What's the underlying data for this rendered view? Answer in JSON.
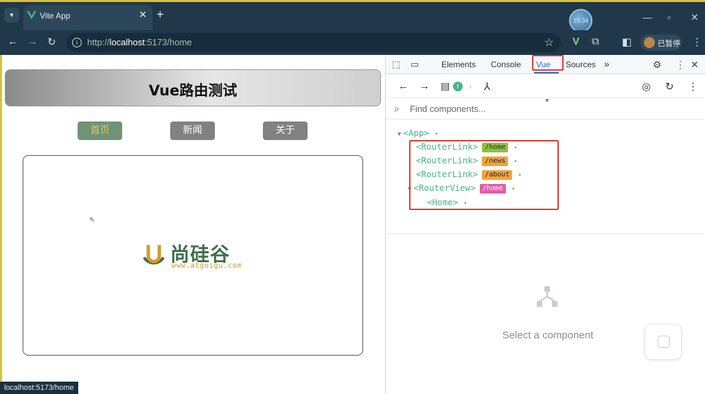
{
  "browser": {
    "tab_title": "Vite App",
    "close": "✕",
    "new_tab": "+",
    "url_prefix": "http://",
    "url_host": "localhost",
    "url_rest": ":5173/home",
    "profile_bubble": "15:34",
    "paused_label": "已暂停",
    "status_url": "localhost:5173/home"
  },
  "page": {
    "heading": "Vue路由测试",
    "nav": [
      {
        "label": "首页",
        "active": true
      },
      {
        "label": "新闻",
        "active": false
      },
      {
        "label": "关于",
        "active": false
      }
    ],
    "logo_cn": "尚硅谷",
    "logo_url": "www.atguigu.com"
  },
  "devtools": {
    "tabs": [
      "Elements",
      "Console",
      "Vue",
      "Sources"
    ],
    "more_tabs": "»",
    "search_placeholder": "Find components...",
    "tree": [
      {
        "name": "<App>",
        "tag": null,
        "tag_color": null,
        "indent": 0,
        "expanded": true
      },
      {
        "name": "<RouterLink>",
        "tag": "/home",
        "tag_color": "green",
        "indent": 1
      },
      {
        "name": "<RouterLink>",
        "tag": "/news",
        "tag_color": "orange",
        "indent": 1
      },
      {
        "name": "<RouterLink>",
        "tag": "/about",
        "tag_color": "orange",
        "indent": 1
      },
      {
        "name": "<RouterView>",
        "tag": "/home",
        "tag_color": "pink",
        "indent": 1,
        "expanded": true
      },
      {
        "name": "<Home>",
        "tag": null,
        "tag_color": null,
        "indent": 2
      }
    ],
    "empty_state": "Select a component"
  },
  "colors": {
    "accent_vue": "#42b883",
    "active_nav_bg": "#6f9475",
    "active_nav_text": "#ecc260",
    "highlight_box": "#e03b31"
  }
}
